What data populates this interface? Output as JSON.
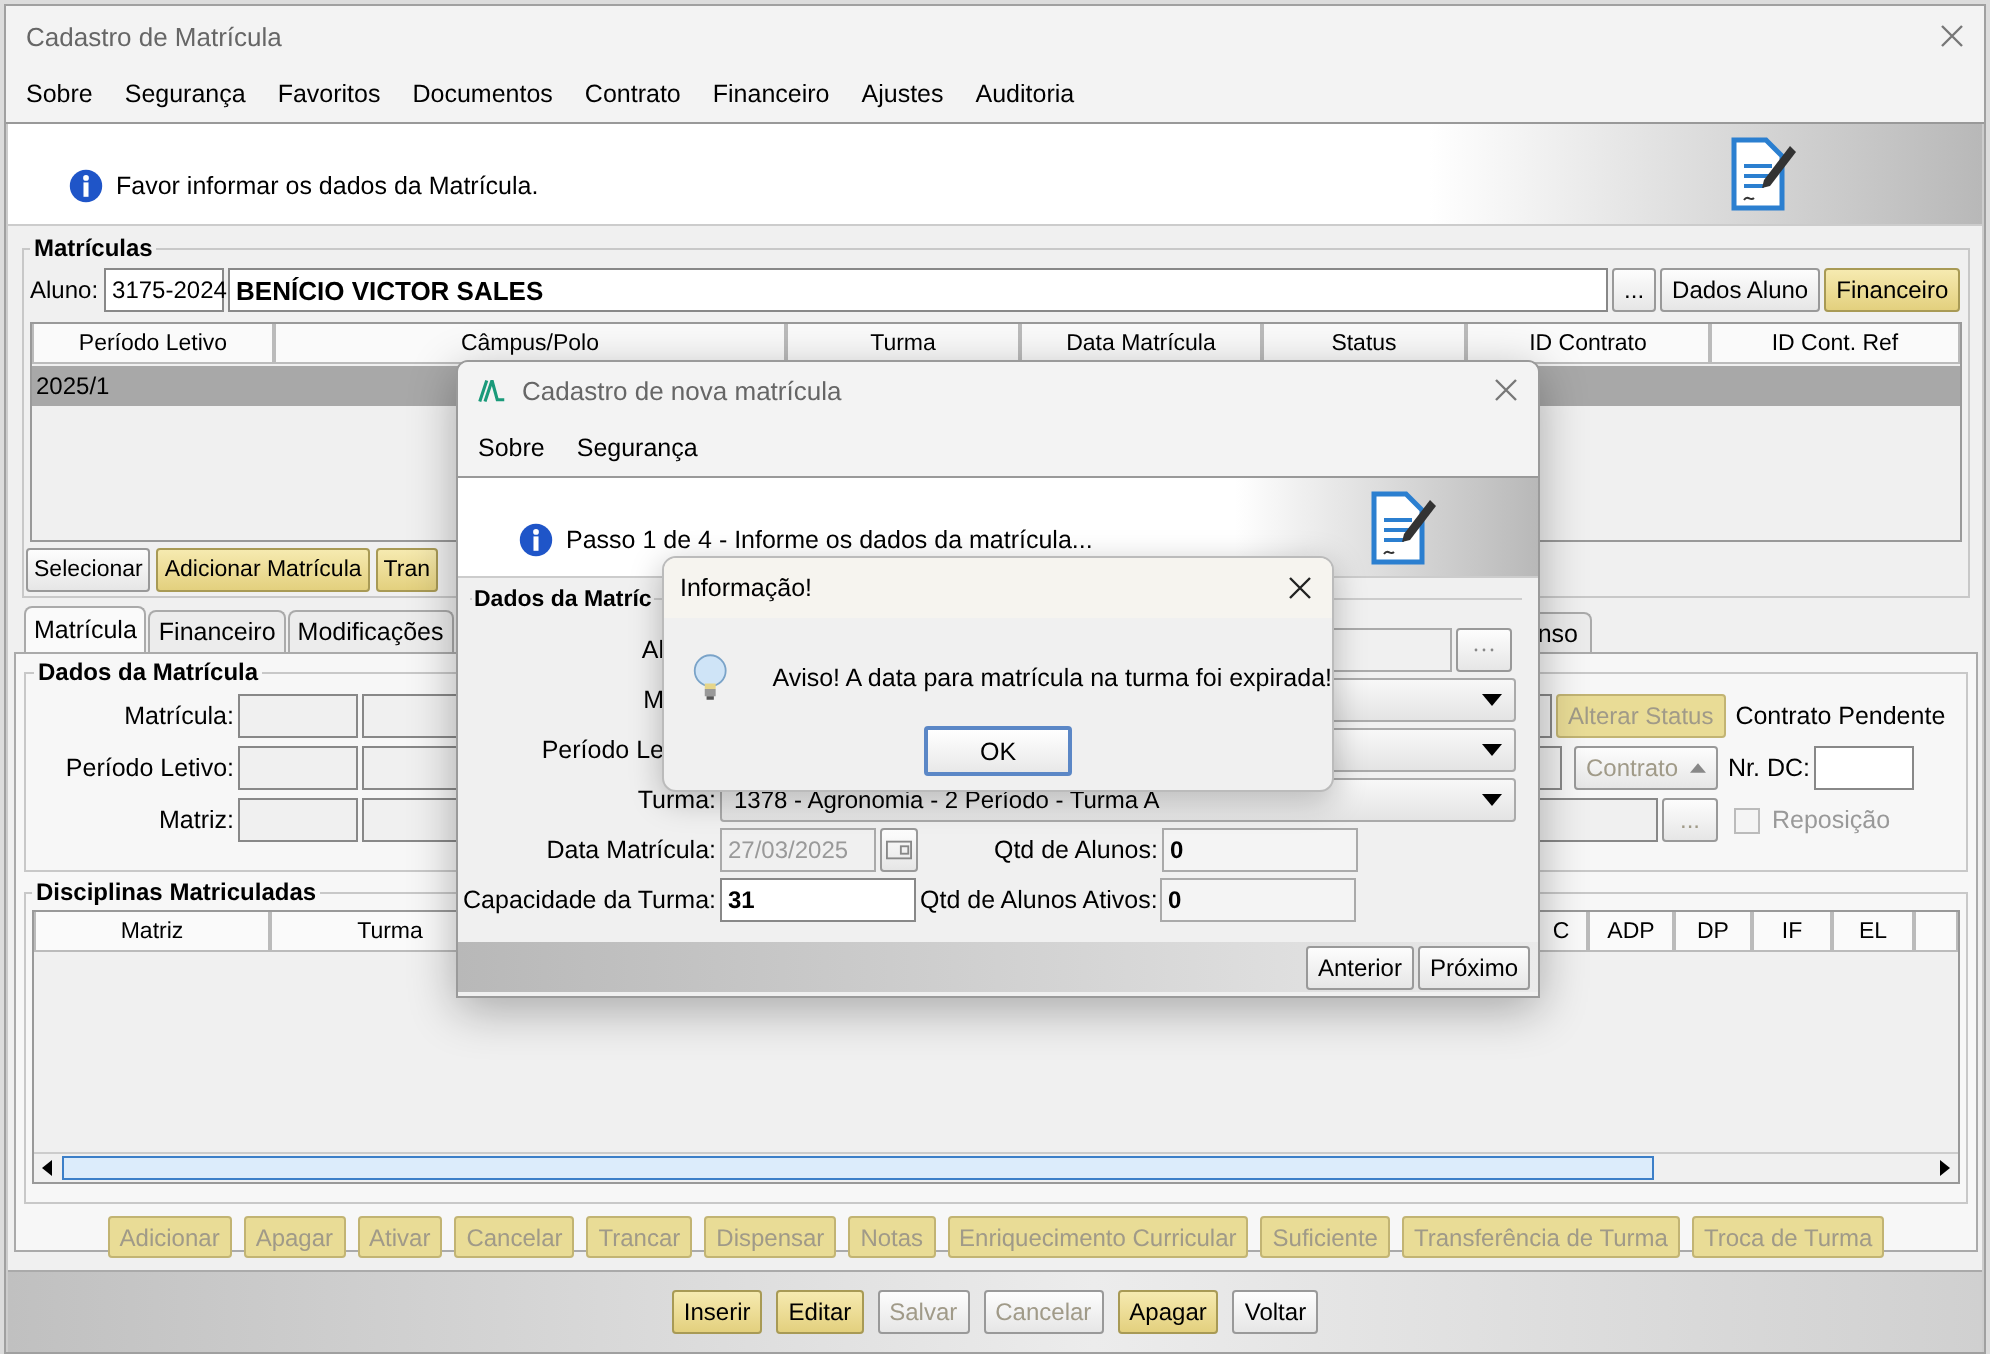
{
  "window": {
    "title": "Cadastro de Matrícula"
  },
  "menu": [
    "Sobre",
    "Segurança",
    "Favoritos",
    "Documentos",
    "Contrato",
    "Financeiro",
    "Ajustes",
    "Auditoria"
  ],
  "banner": {
    "message": "Favor informar os dados da Matrícula."
  },
  "matriculas": {
    "title": "Matrículas",
    "aluno_label": "Aluno:",
    "aluno_code": "3175-2024",
    "aluno_name": "BENÍCIO VICTOR SALES",
    "buttons": [
      {
        "label": "...",
        "kind": "plain"
      },
      {
        "label": "Dados Aluno",
        "kind": "plain"
      },
      {
        "label": "Financeiro",
        "kind": "accent"
      }
    ],
    "columns": [
      "Período Letivo",
      "Câmpus/Polo",
      "Turma",
      "Data Matrícula",
      "Status",
      "ID Contrato",
      "ID Cont. Ref"
    ],
    "rows": [
      {
        "cells": [
          "2025/1"
        ],
        "selected": true
      }
    ],
    "actions": [
      {
        "label": "Selecionar",
        "kind": "plain"
      },
      {
        "label": "Adicionar Matrícula",
        "kind": "accent"
      },
      {
        "label": "Tran",
        "kind": "accent"
      }
    ]
  },
  "tabs": [
    {
      "label": "Matrícula",
      "selected": true
    },
    {
      "label": "Financeiro",
      "selected": false
    },
    {
      "label": "Modificações",
      "selected": false
    },
    {
      "label": "nso",
      "selected": false
    }
  ],
  "dados": {
    "title": "Dados da Matrícula",
    "fields": [
      "Matrícula:",
      "Período Letivo:",
      "Matriz:"
    ],
    "alterar_status": {
      "label": "Alterar Status",
      "disabled": true
    },
    "status_text": "Contrato Pendente",
    "contrato_button": {
      "label": "Contrato",
      "disabled": true
    },
    "nr_dc_label": "Nr. DC:",
    "lookup_button": {
      "label": "...",
      "disabled": true
    },
    "reposicao": {
      "label": "Reposição",
      "checked": false,
      "disabled": true
    }
  },
  "disciplinas": {
    "title": "Disciplinas Matriculadas",
    "columns": [
      "Matriz",
      "Turma",
      "C",
      "ADP",
      "DP",
      "IF",
      "EL"
    ],
    "actions": [
      {
        "label": "Adicionar",
        "disabled": true
      },
      {
        "label": "Apagar",
        "disabled": true
      },
      {
        "label": "Ativar",
        "disabled": true
      },
      {
        "label": "Cancelar",
        "disabled": true
      },
      {
        "label": "Trancar",
        "disabled": true
      },
      {
        "label": "Dispensar",
        "disabled": true
      },
      {
        "label": "Notas",
        "disabled": true
      },
      {
        "label": "Enriquecimento Curricular",
        "disabled": true
      },
      {
        "label": "Suficiente",
        "disabled": true
      },
      {
        "label": "Transferência de Turma",
        "disabled": true
      },
      {
        "label": "Troca de Turma",
        "disabled": true
      }
    ]
  },
  "bottom_buttons": [
    {
      "label": "Inserir",
      "kind": "accent",
      "disabled": false
    },
    {
      "label": "Editar",
      "kind": "accent",
      "disabled": false
    },
    {
      "label": "Salvar",
      "kind": "plain",
      "disabled": true
    },
    {
      "label": "Cancelar",
      "kind": "plain",
      "disabled": true
    },
    {
      "label": "Apagar",
      "kind": "accent",
      "disabled": false
    },
    {
      "label": "Voltar",
      "kind": "plain",
      "disabled": false
    }
  ],
  "wizard": {
    "title": "Cadastro de nova matrícula",
    "menu": [
      "Sobre",
      "Segurança"
    ],
    "step": "Passo 1 de 4 - Informe os dados da matrícula...",
    "group_title": "Dados da Matríc",
    "covered_rows": [
      {
        "label": "Al",
        "kind": "lookup"
      },
      {
        "label": "M",
        "kind": "select"
      },
      {
        "label": "Período Le",
        "kind": "select"
      }
    ],
    "turma": {
      "label": "Turma:",
      "value": "1378 - Agronomia - 2 Período - Turma A"
    },
    "data_matricula": {
      "label": "Data Matrícula:",
      "value": "27/03/2025",
      "disabled": true
    },
    "qtd_alunos": {
      "label": "Qtd de Alunos:",
      "value": "0"
    },
    "capacidade": {
      "label": "Capacidade da Turma:",
      "value": "31"
    },
    "qtd_ativos": {
      "label": "Qtd de Alunos Ativos:",
      "value": "0"
    },
    "buttons": [
      "Anterior",
      "Próximo"
    ]
  },
  "info_dialog": {
    "title": "Informação!",
    "message": "Aviso! A data para matrícula na turma foi expirada!",
    "button": "OK"
  }
}
